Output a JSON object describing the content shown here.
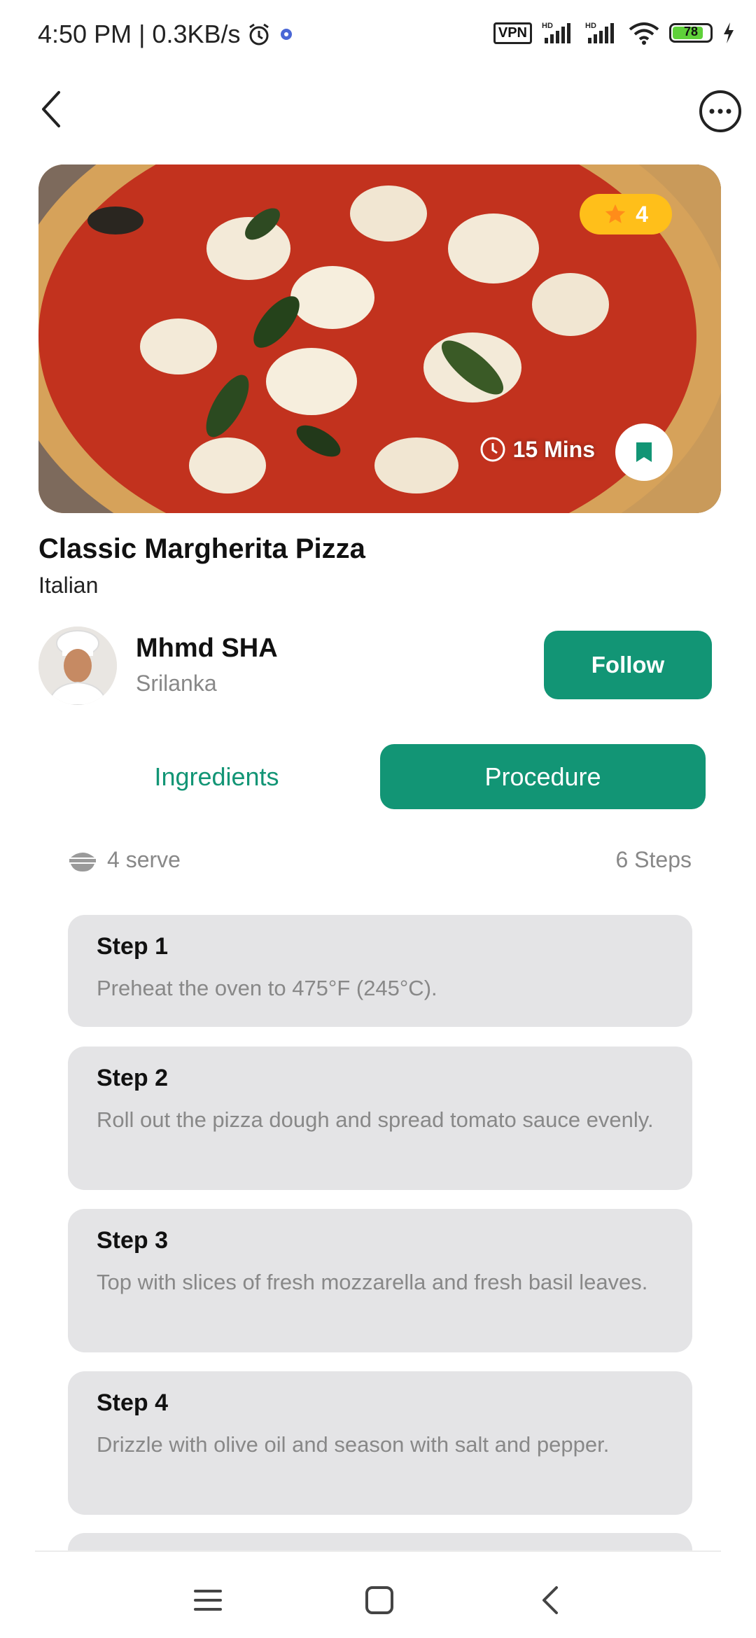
{
  "status_bar": {
    "time": "4:50 PM | 0.3KB/s",
    "vpn": "VPN",
    "battery": "78",
    "icons": [
      "alarm-icon",
      "settings-dot-icon",
      "signal-hd-icon",
      "signal-hd-icon",
      "wifi-icon",
      "charging-icon"
    ]
  },
  "header": {
    "back_icon": "chevron-left-icon",
    "more_icon": "more-options-icon"
  },
  "recipe": {
    "rating": "4",
    "time": "15 Mins",
    "title": "Classic Margherita Pizza",
    "cuisine": "Italian"
  },
  "author": {
    "name": "Mhmd SHA",
    "location": "Srilanka",
    "follow_label": "Follow"
  },
  "tabs": [
    {
      "label": "Ingredients",
      "active": false
    },
    {
      "label": "Procedure",
      "active": true
    }
  ],
  "meta": {
    "serves": "4 serve",
    "steps_count": "6 Steps"
  },
  "steps": [
    {
      "title": "Step 1",
      "text": "Preheat the oven to 475°F (245°C)."
    },
    {
      "title": "Step 2",
      "text": "Roll out the pizza dough and spread tomato sauce evenly."
    },
    {
      "title": "Step 3",
      "text": "Top with slices of fresh mozzarella and fresh basil leaves."
    },
    {
      "title": "Step 4",
      "text": "Drizzle with olive oil and season with salt and pepper."
    }
  ],
  "colors": {
    "accent": "#129575",
    "rating_bg": "#ffbf1a",
    "card_bg": "#e4e4e6"
  }
}
